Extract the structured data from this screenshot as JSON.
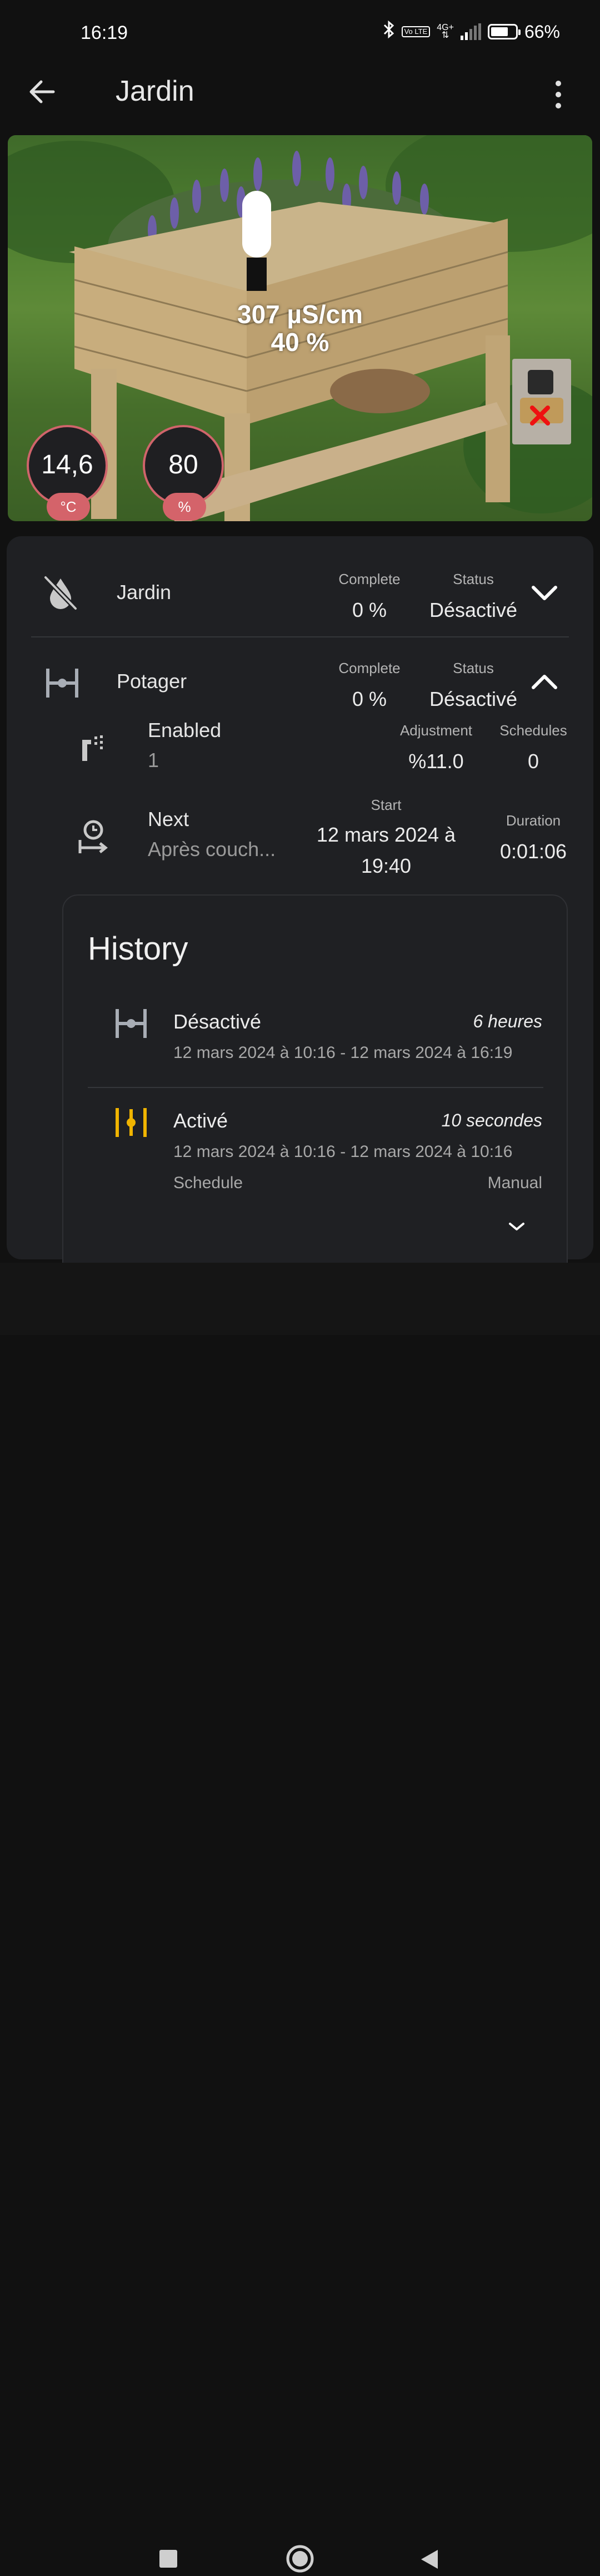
{
  "status_bar": {
    "time": "16:19",
    "network": "4G+",
    "volte": "Vo LTE",
    "battery": "66%"
  },
  "app_bar": {
    "title": "Jardin"
  },
  "picture": {
    "ec_value": "307 µS/cm",
    "moisture": "40 %",
    "temperature": {
      "value": "14,6",
      "unit": "°C"
    },
    "humidity": {
      "value": "80",
      "unit": "%"
    }
  },
  "zones": [
    {
      "name": "Jardin",
      "complete_label": "Complete",
      "complete_value": "0 %",
      "status_label": "Status",
      "status_value": "Désactivé"
    },
    {
      "name": "Potager",
      "complete_label": "Complete",
      "complete_value": "0 %",
      "status_label": "Status",
      "status_value": "Désactivé"
    }
  ],
  "details": {
    "enabled_label": "Enabled",
    "enabled_value": "1",
    "adjustment_label": "Adjustment",
    "adjustment_value": "%11.0",
    "schedules_label": "Schedules",
    "schedules_value": "0",
    "next_label": "Next",
    "next_value": "Après couch...",
    "start_label": "Start",
    "start_line1": "12 mars 2024 à",
    "start_line2": "19:40",
    "duration_label": "Duration",
    "duration_value": "0:01:06"
  },
  "history": {
    "title": "History",
    "entries": [
      {
        "name": "Désactivé",
        "duration": "6 heures",
        "range": "12 mars 2024 à 10:16 - 12 mars 2024 à 16:19",
        "icon_color": "#a8adb5"
      },
      {
        "name": "Activé",
        "duration": "10 secondes",
        "range": "12 mars 2024 à 10:16 - 12 mars 2024 à 10:16",
        "icon_color": "#f0b400",
        "schedule_label": "Schedule",
        "schedule_value": "Manual"
      }
    ]
  },
  "colors": {
    "background": "#111111",
    "card": "#1f2023",
    "accent_red": "#d4636a",
    "active_yellow": "#f0b400"
  }
}
